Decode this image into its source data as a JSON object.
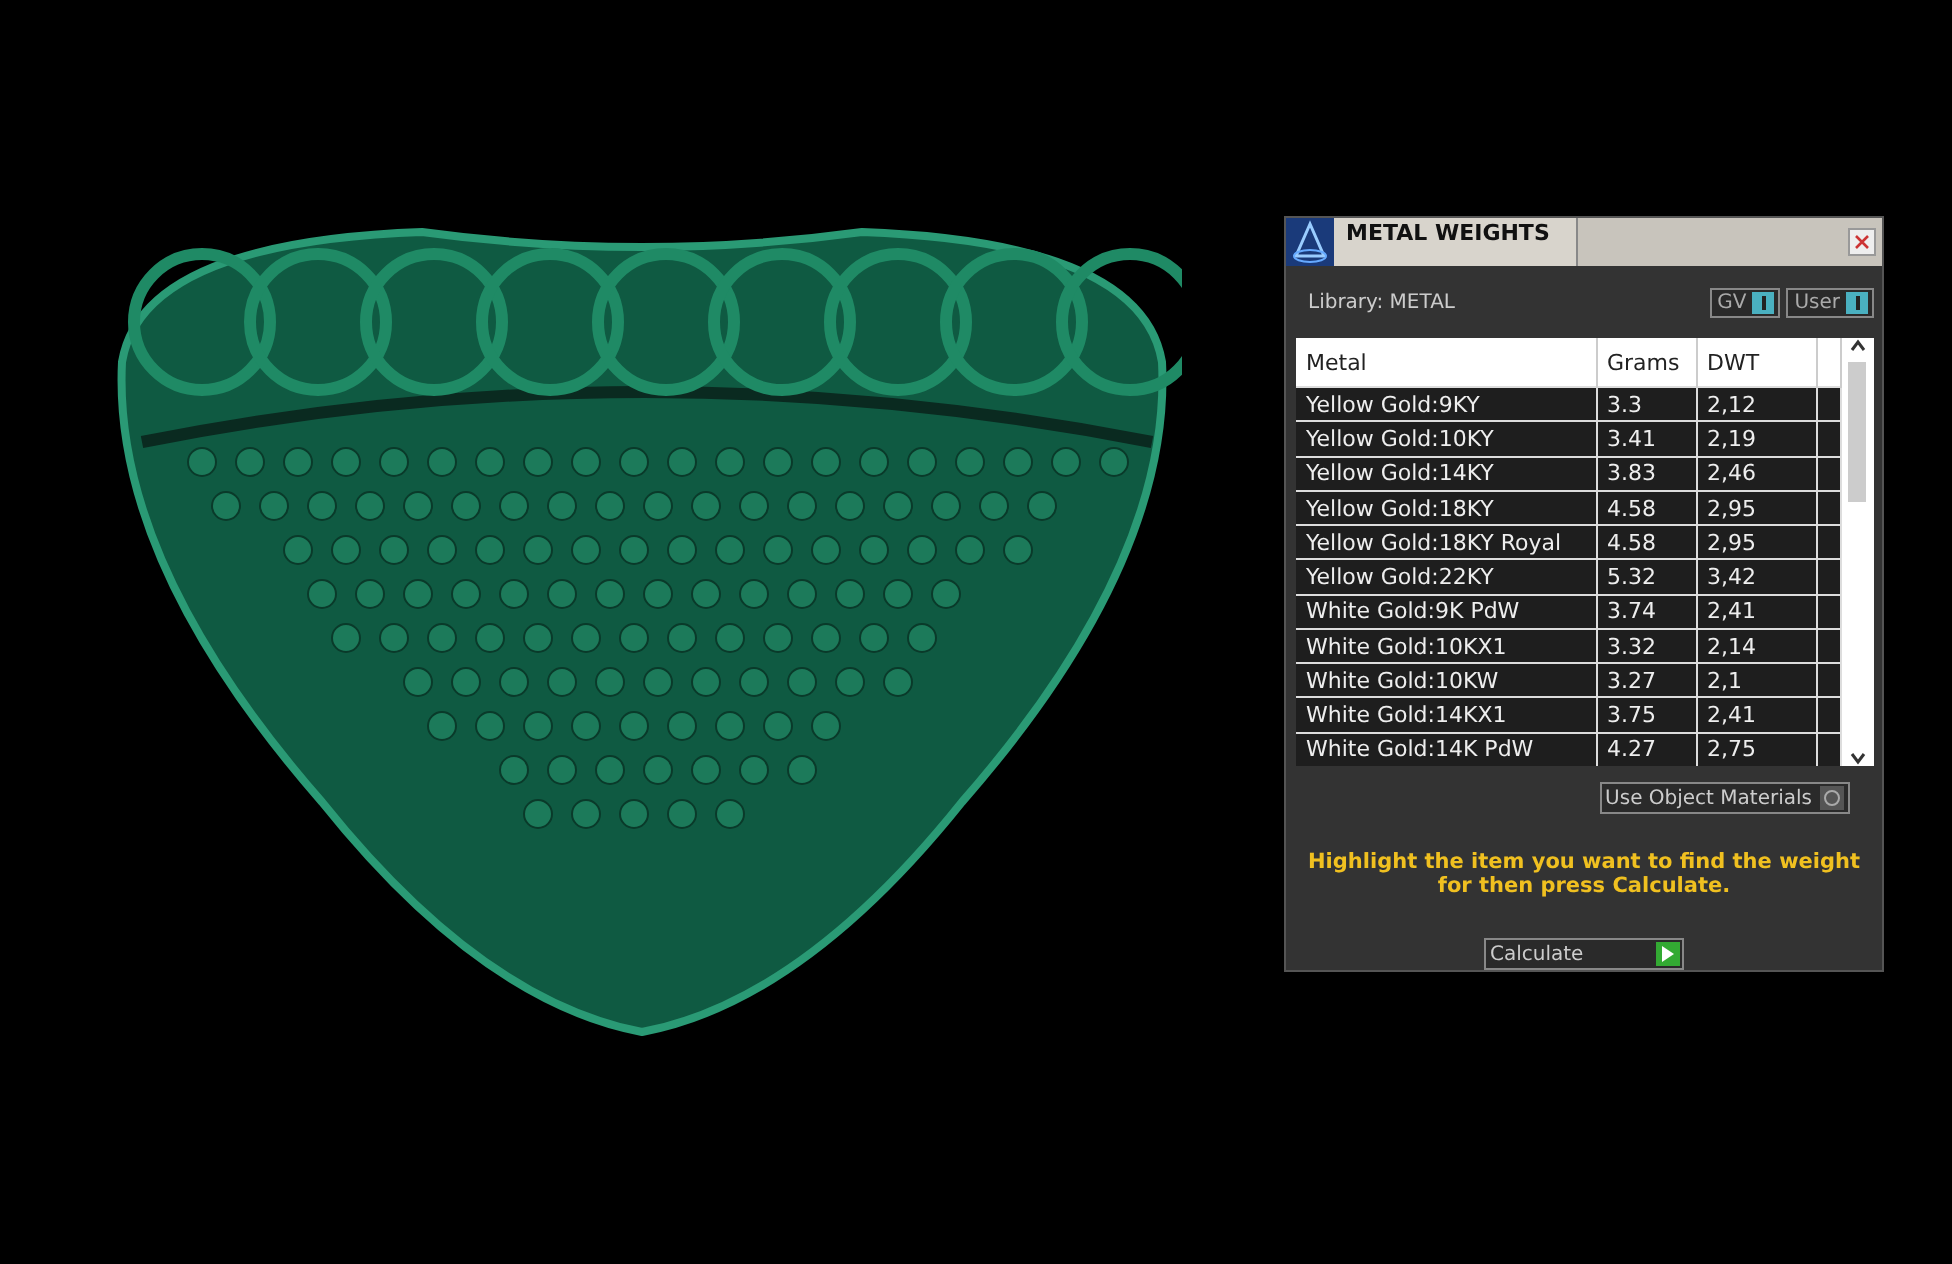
{
  "panel": {
    "title": "METAL WEIGHTS",
    "library_label": "Library: METAL",
    "toggles": [
      {
        "label": "GV",
        "on": true
      },
      {
        "label": "User",
        "on": true
      }
    ],
    "table": {
      "columns": [
        "Metal",
        "Grams",
        "DWT"
      ],
      "rows": [
        {
          "metal": "Yellow Gold:9KY",
          "grams": "3.3",
          "dwt": "2,12"
        },
        {
          "metal": "Yellow Gold:10KY",
          "grams": "3.41",
          "dwt": "2,19"
        },
        {
          "metal": "Yellow Gold:14KY",
          "grams": "3.83",
          "dwt": "2,46"
        },
        {
          "metal": "Yellow Gold:18KY",
          "grams": "4.58",
          "dwt": "2,95"
        },
        {
          "metal": "Yellow Gold:18KY Royal",
          "grams": "4.58",
          "dwt": "2,95"
        },
        {
          "metal": "Yellow Gold:22KY",
          "grams": "5.32",
          "dwt": "3,42"
        },
        {
          "metal": "White Gold:9K PdW",
          "grams": "3.74",
          "dwt": "2,41"
        },
        {
          "metal": "White Gold:10KX1",
          "grams": "3.32",
          "dwt": "2,14"
        },
        {
          "metal": "White Gold:10KW",
          "grams": "3.27",
          "dwt": "2,1"
        },
        {
          "metal": "White Gold:14KX1",
          "grams": "3.75",
          "dwt": "2,41"
        },
        {
          "metal": "White Gold:14K PdW",
          "grams": "4.27",
          "dwt": "2,75"
        }
      ]
    },
    "use_object_materials": {
      "label": "Use Object Materials",
      "checked": false
    },
    "instruction": "Highlight the item you want to find the weight for then press Calculate.",
    "calculate_button": "Calculate"
  }
}
